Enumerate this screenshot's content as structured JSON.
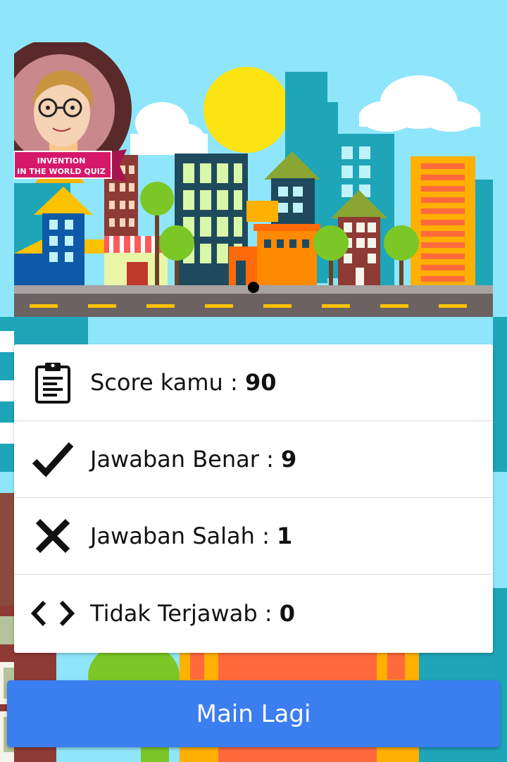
{
  "logo": {
    "line1": "INVENTION",
    "line2": "IN THE WORLD QUIZ"
  },
  "results": [
    {
      "icon": "clipboard-icon",
      "label": "Score kamu : ",
      "value": "90"
    },
    {
      "icon": "checkmark-icon",
      "label": "Jawaban Benar : ",
      "value": "9"
    },
    {
      "icon": "close-x-icon",
      "label": "Jawaban Salah : ",
      "value": "1"
    },
    {
      "icon": "code-brackets-icon",
      "label": "Tidak Terjawab : ",
      "value": "0"
    }
  ],
  "play_again_button": "Main Lagi",
  "colors": {
    "sky": "#8fe6fb",
    "button": "#3b7ef0",
    "sun": "#fce311",
    "road": "#6b6261"
  }
}
